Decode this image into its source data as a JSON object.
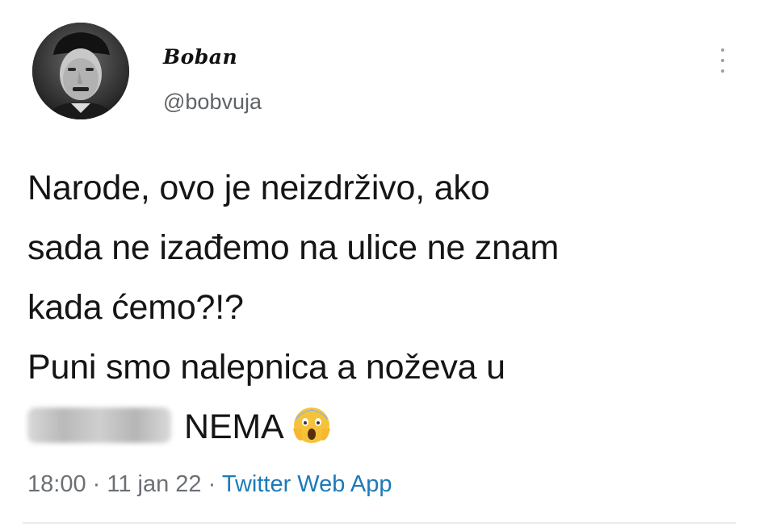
{
  "tweet": {
    "author": {
      "display_name": "Boban",
      "handle": "@bobvuja",
      "avatar": "avatar-photo"
    },
    "more_icon": "more-vertical-icon",
    "text_lines": [
      "Narode, ovo je neizdrživo, ako",
      "sada ne izađemo na ulice ne znam",
      "kada ćemo?!?",
      "Puni smo nalepnica a noževa u",
      "NEMA"
    ],
    "blurred_word": "redacted-blurred-text",
    "emoji": "screaming-face-emoji",
    "time": "18:00",
    "separator": "·",
    "date": "11 jan 22",
    "source": "Twitter Web App"
  }
}
